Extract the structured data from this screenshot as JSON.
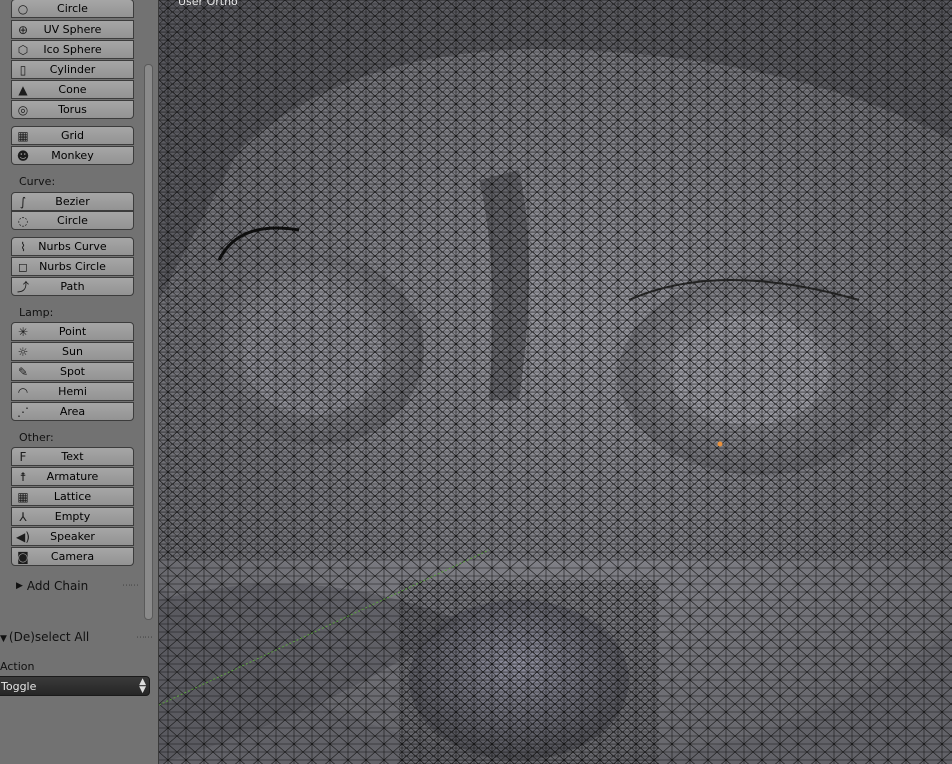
{
  "viewport": {
    "view_label": "User Ortho"
  },
  "toolshelf": {
    "mesh_buttons": [
      {
        "label": "Circle",
        "icon": "circle-icon",
        "glyph": "○"
      },
      {
        "label": "UV Sphere",
        "icon": "uv-sphere-icon",
        "glyph": "⊕"
      },
      {
        "label": "Ico Sphere",
        "icon": "ico-sphere-icon",
        "glyph": "⬡"
      },
      {
        "label": "Cylinder",
        "icon": "cylinder-icon",
        "glyph": "▯"
      },
      {
        "label": "Cone",
        "icon": "cone-icon",
        "glyph": "▲"
      },
      {
        "label": "Torus",
        "icon": "torus-icon",
        "glyph": "◎"
      },
      {
        "label": "Grid",
        "icon": "grid-icon",
        "glyph": "▦"
      },
      {
        "label": "Monkey",
        "icon": "monkey-icon",
        "glyph": "☻"
      }
    ],
    "curve_label": "Curve:",
    "curve_buttons": [
      {
        "label": "Bezier",
        "icon": "bezier-icon",
        "glyph": "∫"
      },
      {
        "label": "Circle",
        "icon": "bezier-circle-icon",
        "glyph": "◌"
      },
      {
        "label": "Nurbs Curve",
        "icon": "nurbs-curve-icon",
        "glyph": "⌇"
      },
      {
        "label": "Nurbs Circle",
        "icon": "nurbs-circle-icon",
        "glyph": "◻"
      },
      {
        "label": "Path",
        "icon": "path-icon",
        "glyph": "⤴"
      }
    ],
    "lamp_label": "Lamp:",
    "lamp_buttons": [
      {
        "label": "Point",
        "icon": "point-lamp-icon",
        "glyph": "✳"
      },
      {
        "label": "Sun",
        "icon": "sun-lamp-icon",
        "glyph": "☼"
      },
      {
        "label": "Spot",
        "icon": "spot-lamp-icon",
        "glyph": "✎"
      },
      {
        "label": "Hemi",
        "icon": "hemi-lamp-icon",
        "glyph": "◠"
      },
      {
        "label": "Area",
        "icon": "area-lamp-icon",
        "glyph": "⋰"
      }
    ],
    "other_label": "Other:",
    "other_buttons": [
      {
        "label": "Text",
        "icon": "text-icon",
        "glyph": "F"
      },
      {
        "label": "Armature",
        "icon": "armature-icon",
        "glyph": "☨"
      },
      {
        "label": "Lattice",
        "icon": "lattice-icon",
        "glyph": "▦"
      },
      {
        "label": "Empty",
        "icon": "empty-icon",
        "glyph": "⅄"
      },
      {
        "label": "Speaker",
        "icon": "speaker-icon",
        "glyph": "◀)"
      },
      {
        "label": "Camera",
        "icon": "camera-icon",
        "glyph": "◙"
      }
    ],
    "add_chain_label": "Add Chain"
  },
  "redo_panel": {
    "title": "(De)select All",
    "action_label": "Action",
    "action_value": "Toggle"
  },
  "colors": {
    "panel_bg": "#727272",
    "button_bg": "#a0a0a0",
    "select_bg": "#2e2e2e",
    "vertex_selected": "#e8903a"
  }
}
